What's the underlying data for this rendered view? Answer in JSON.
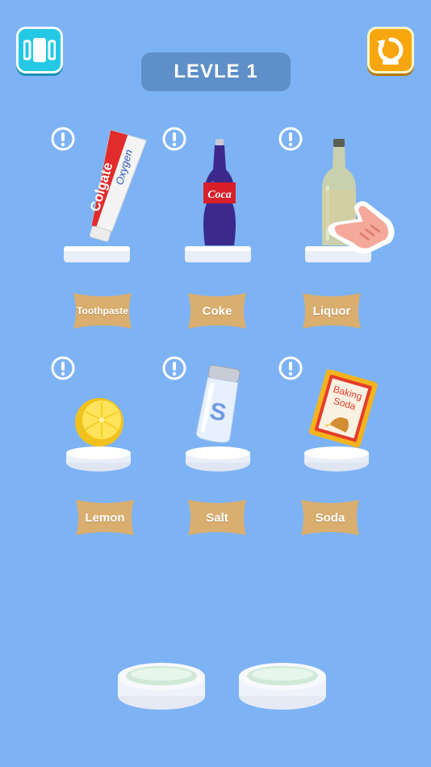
{
  "header": {
    "level_text": "LEVLE 1",
    "menu_icon": "cards-menu-icon",
    "restart_icon": "restart-arrow-icon"
  },
  "items": [
    {
      "label": "Toothpaste",
      "icon": "colgate-toothpaste-icon",
      "tube_brand": "Colgate",
      "tube_sub": "Oxygen"
    },
    {
      "label": "Coke",
      "icon": "coke-bottle-icon",
      "bottle_text": "Coca"
    },
    {
      "label": "Liquor",
      "icon": "liquor-bottle-icon"
    },
    {
      "label": "Lemon",
      "icon": "lemon-icon"
    },
    {
      "label": "Salt",
      "icon": "salt-shaker-icon",
      "shaker_letter": "S"
    },
    {
      "label": "Soda",
      "icon": "baking-soda-box-icon",
      "box_text_1": "Baking",
      "box_text_2": "Soda"
    }
  ],
  "colors": {
    "background": "#7db3f5",
    "label_tag": "#d9ae6e",
    "menu_button": "#23c8e4",
    "restart_button": "#f7a70d"
  }
}
